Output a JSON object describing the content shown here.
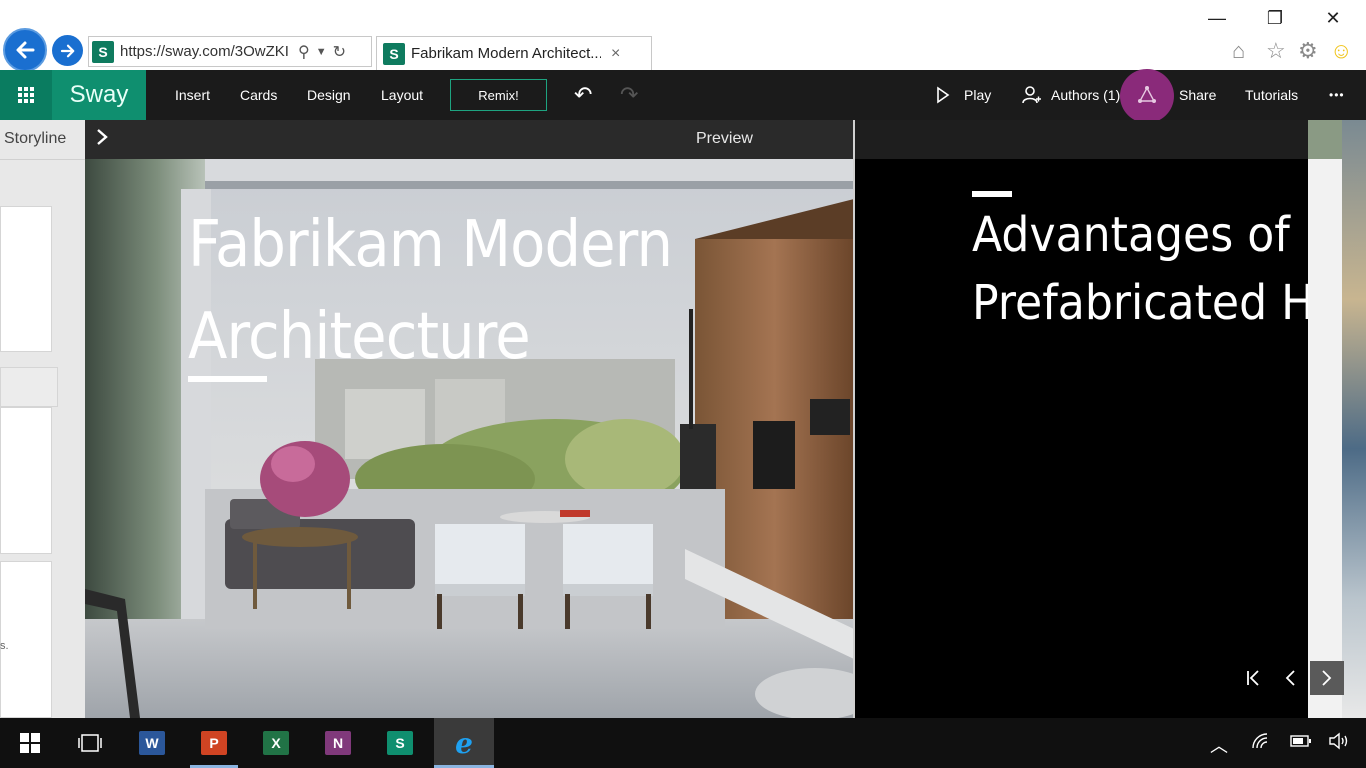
{
  "browser": {
    "url": "https://sway.com/3OwZKI",
    "tab_title": "Fabrikam Modern Architect...",
    "tab_close": "×",
    "favicon_letter": "S"
  },
  "toolbar": {
    "brand": "Sway",
    "menu": [
      "Insert",
      "Cards",
      "Design",
      "Layout"
    ],
    "remix_label": "Remix!",
    "play_label": "Play",
    "authors_label": "Authors (1)",
    "share_label": "Share",
    "tutorials_label": "Tutorials",
    "more_label": "•••"
  },
  "storyline": {
    "label": "Storyline",
    "snippet": "s."
  },
  "preview": {
    "header_title": "Preview",
    "slide1_title": "Fabrikam Modern Architecture",
    "slide2_title_line1": "Advantages of",
    "slide2_title_line2": "Prefabricated H"
  },
  "taskbar": {
    "apps": [
      {
        "name": "word",
        "letter": "W",
        "color": "#2b579a"
      },
      {
        "name": "powerpoint",
        "letter": "P",
        "color": "#d04423"
      },
      {
        "name": "excel",
        "letter": "X",
        "color": "#217346"
      },
      {
        "name": "onenote",
        "letter": "N",
        "color": "#80397b"
      },
      {
        "name": "sway",
        "letter": "S",
        "color": "#0f8f6f"
      },
      {
        "name": "internet-explorer",
        "letter": "e",
        "color": "#1ea1f1"
      }
    ]
  },
  "colors": {
    "sway_green": "#0f8f6f",
    "share_purple": "#8a2a7a",
    "toolbar_bg": "#1b1b1b"
  }
}
